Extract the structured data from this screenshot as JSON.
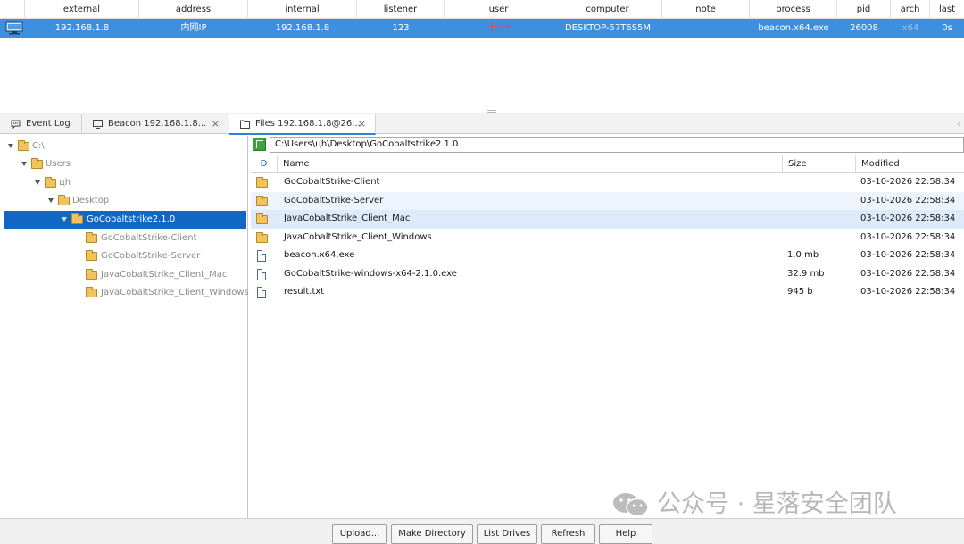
{
  "beacon_table": {
    "columns": [
      "external",
      "address",
      "internal",
      "listener",
      "user",
      "computer",
      "note",
      "process",
      "pid",
      "arch",
      "last"
    ],
    "row": {
      "external": "192.168.1.8",
      "address": "内网IP",
      "internal": "192.168.1.8",
      "listener": "123",
      "user": "十一*",
      "computer": "DESKTOP-57T6S5M",
      "note": "",
      "process": "beacon.x64.exe",
      "pid": "26008",
      "arch": "x64",
      "last": "0s"
    }
  },
  "tabs": [
    {
      "label": "Event Log",
      "icon": "chat-icon"
    },
    {
      "label": "Beacon 192.168.1.8...",
      "icon": "monitor-icon",
      "close": "×"
    },
    {
      "label": "Files 192.168.1.8@26...",
      "icon": "folder-outline-icon",
      "close": "×"
    }
  ],
  "tree": [
    {
      "label": "C:\\",
      "level": 0,
      "expanded": true,
      "style": "gray"
    },
    {
      "label": "Users",
      "level": 1,
      "expanded": true,
      "style": "gray"
    },
    {
      "label": "цh",
      "level": 2,
      "expanded": true,
      "style": "gray"
    },
    {
      "label": "Desktop",
      "level": 3,
      "expanded": true,
      "style": "gray"
    },
    {
      "label": "GoCobaltstrike2.1.0",
      "level": 4,
      "expanded": true,
      "style": "selected"
    },
    {
      "label": "GoCobaltStrike-Client",
      "level": 5,
      "style": "gray"
    },
    {
      "label": "GoCobaltStrike-Server",
      "level": 5,
      "style": "gray"
    },
    {
      "label": "JavaCobaltStrike_Client_Mac",
      "level": 5,
      "style": "gray"
    },
    {
      "label": "JavaCobaltStrike_Client_Windows",
      "level": 5,
      "style": "gray"
    }
  ],
  "path": {
    "value": "C:\\Users\\цh\\Desktop\\GoCobaltstrike2.1.0"
  },
  "files": {
    "headers": {
      "d": "D",
      "name": "Name",
      "size": "Size",
      "modified": "Modified"
    },
    "rows": [
      {
        "type": "folder",
        "name": "GoCobaltStrike-Client",
        "size": "",
        "modified": "03-10-2026 22:58:34"
      },
      {
        "type": "folder",
        "name": "GoCobaltStrike-Server",
        "size": "",
        "modified": "03-10-2026 22:58:34"
      },
      {
        "type": "folder",
        "name": "JavaCobaltStrike_Client_Mac",
        "size": "",
        "modified": "03-10-2026 22:58:34"
      },
      {
        "type": "folder",
        "name": "JavaCobaltStrike_Client_Windows",
        "size": "",
        "modified": "03-10-2026 22:58:34"
      },
      {
        "type": "file",
        "name": "beacon.x64.exe",
        "size": "1.0 mb",
        "modified": "03-10-2026 22:58:34"
      },
      {
        "type": "file",
        "name": "GoCobaltStrike-windows-x64-2.1.0.exe",
        "size": "32.9 mb",
        "modified": "03-10-2026 22:58:34"
      },
      {
        "type": "file",
        "name": "result.txt",
        "size": "945 b",
        "modified": "03-10-2026 22:58:34"
      }
    ]
  },
  "buttons": {
    "upload": "Upload...",
    "make_directory": "Make Directory",
    "list_drives": "List Drives",
    "refresh": "Refresh",
    "help": "Help"
  },
  "watermark": {
    "text": "公众号 · 星落安全团队"
  },
  "colors": {
    "selection": "#3d8fe0",
    "tree_selection": "#1167c4",
    "folder": "#efc35e",
    "accent": "#2f80d8"
  }
}
